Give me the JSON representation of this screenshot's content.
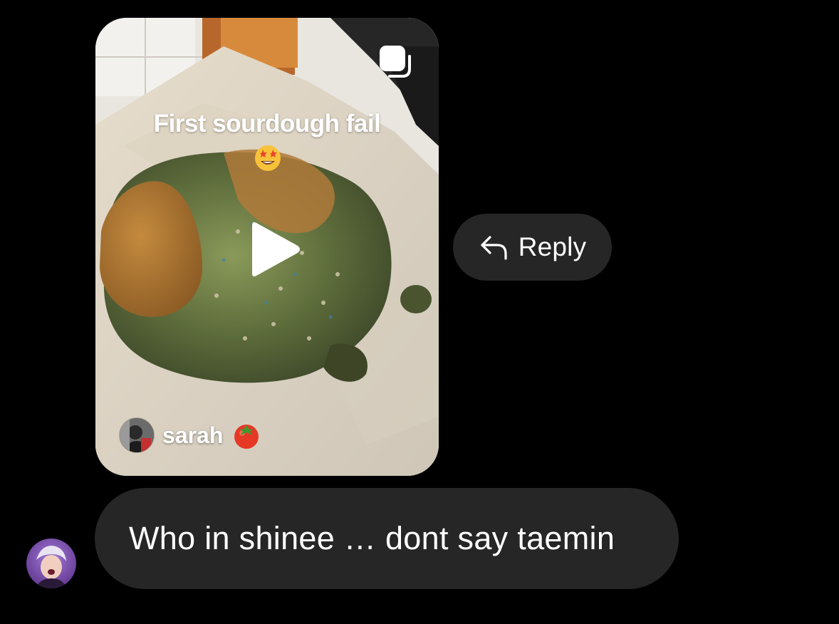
{
  "shared_reel": {
    "caption": "First sourdough fail",
    "caption_emoji": "star-struck-emoji",
    "author_name": "sarah",
    "author_emoji": "tomato-emoji",
    "multi_post_icon": "multiple-posts-icon",
    "play_icon": "play-icon"
  },
  "reply": {
    "label": "Reply",
    "icon": "reply-arrow-icon"
  },
  "message": {
    "text": "Who in shinee … dont say taemin"
  },
  "colors": {
    "background": "#000000",
    "bubble": "#262626",
    "text": "#ffffff"
  }
}
